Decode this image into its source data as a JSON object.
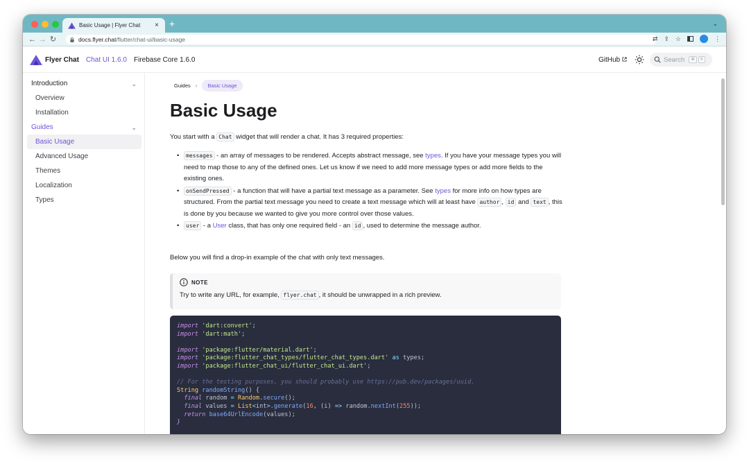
{
  "browser": {
    "tab_title": "Basic Usage | Flyer Chat",
    "tab_close": "×",
    "new_tab": "+",
    "url_host": "docs.flyer.chat",
    "url_path": "/flutter/chat-ui/basic-usage"
  },
  "header": {
    "brand": "Flyer Chat",
    "nav": [
      {
        "label": "Chat UI 1.6.0"
      },
      {
        "label": "Firebase Core 1.6.0"
      }
    ],
    "github": "GitHub",
    "search_placeholder": "Search",
    "search_keys": [
      "⌘",
      "K"
    ]
  },
  "sidebar": {
    "items": [
      {
        "label": "Introduction"
      },
      {
        "label": "Overview"
      },
      {
        "label": "Installation"
      },
      {
        "label": "Guides"
      },
      {
        "label": "Basic Usage"
      },
      {
        "label": "Advanced Usage"
      },
      {
        "label": "Themes"
      },
      {
        "label": "Localization"
      },
      {
        "label": "Types"
      }
    ]
  },
  "content": {
    "breadcrumbs": {
      "home": "Guides",
      "current": "Basic Usage"
    },
    "title": "Basic Usage",
    "intro": {
      "before": "You start with a ",
      "code": "Chat",
      "after": " widget that will render a chat. It has 3 required properties:"
    },
    "props": {
      "p1": {
        "code": "messages",
        "t1": " - an array of messages to be rendered. Accepts abstract message, see ",
        "link": "types",
        "t2": ". If you have your message types you will need to map those to any of the defined ones. Let us know if we need to add more message types or add more fields to the existing ones."
      },
      "p2": {
        "code": "onSendPressed",
        "t1": " - a function that will have a partial text message as a parameter. See ",
        "link": "types",
        "t2": " for more info on how types are structured. From the partial text message you need to create a text message which will at least have ",
        "c2": "author",
        "t3": ", ",
        "c3": "id",
        "t4": " and ",
        "c4": "text",
        "t5": ", this is done by you because we wanted to give you more control over those values."
      },
      "p3": {
        "code": "user",
        "t1": " - a ",
        "link": "User",
        "t2": " class, that has only one required field - an ",
        "c2": "id",
        "t3": ", used to determine the message author."
      }
    },
    "below": "Below you will find a drop-in example of the chat with only text messages.",
    "note": {
      "label": "NOTE",
      "before": "Try to write any URL, for example, ",
      "code": "flyer.chat",
      "after": ", it should be unwrapped in a rich preview."
    },
    "code": {
      "import_kw": "import",
      "as_kw": "as",
      "final_kw": "final",
      "return_kw": "return",
      "imp1": "'dart:convert'",
      "imp2": "'dart:math'",
      "imp3": "'package:flutter/material.dart'",
      "imp4": "'package:flutter_chat_types/flutter_chat_types.dart'",
      "imp4_alias": "types",
      "imp5": "'package:flutter_chat_ui/flutter_chat_ui.dart'",
      "semi": ";",
      "comment": "// For the testing purposes, you should probably use https://pub.dev/packages/uuid.",
      "string_type": "String",
      "fn_name": "randomString",
      "fn_sig": "() {",
      "random_var": "random",
      "random_class": "Random",
      "secure": "secure",
      "values_var": "values",
      "list_type": "List",
      "int_type": "int",
      "generate": "generate",
      "num16": "16",
      "lambda_param": "(i)",
      "arrow": "=>",
      "random_obj": "random",
      "nextint": "nextInt",
      "num255": "255",
      "encode_fn": "base64UrlEncode",
      "close_brace": "}"
    }
  },
  "colors": {
    "accent": "#6f53d6",
    "tab_strip": "#6fb8c3",
    "code_bg": "#292d3e"
  }
}
